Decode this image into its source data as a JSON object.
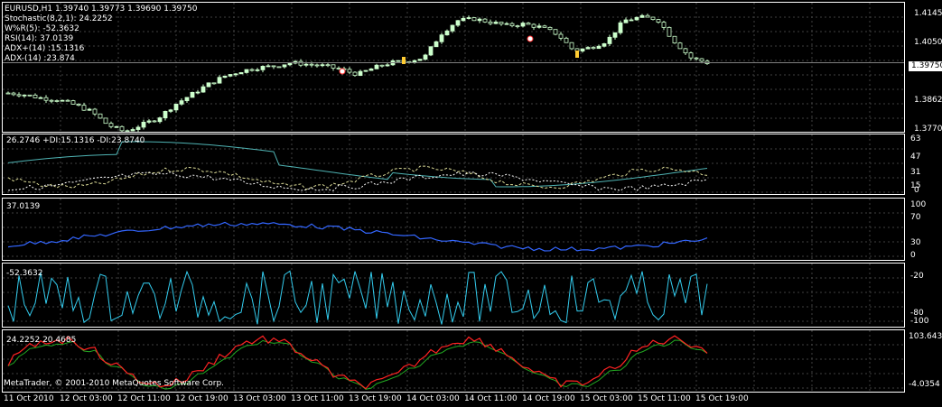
{
  "chart": {
    "header": "EURUSD,H1  1.39740 1.39773 1.39690 1.39750",
    "indicators_legend": [
      "Stochastic(8,2,1): 24.2252",
      "W%R(5): -52.3632",
      "RSI(14): 37.0139",
      "ADX+(14) :15.1316",
      "ADX-(14) :23.874"
    ],
    "current_price": "1.39750",
    "price_scale": [
      "1.41450",
      "1.40500",
      "1.39750",
      "1.38625",
      "1.37700"
    ],
    "copyright": "MetaTrader, © 2001-2010 MetaQuotes Software Corp."
  },
  "adx_pane": {
    "label": "26.2746  +DI:15.1316  -DI:23.8740",
    "scale": [
      "63",
      "47",
      "31",
      "15",
      "0"
    ]
  },
  "rsi_pane": {
    "label": "37.0139",
    "scale": [
      "100",
      "70",
      "30",
      "0"
    ]
  },
  "wpr_pane": {
    "label": "-52.3632",
    "scale": [
      "-20",
      "-80",
      "-100"
    ]
  },
  "stoch_pane": {
    "label": "24.2252  20.4685",
    "scale": [
      "103.6430",
      "-4.0354"
    ]
  },
  "time_axis": [
    "11 Oct 2010",
    "12 Oct 03:00",
    "12 Oct 11:00",
    "12 Oct 19:00",
    "13 Oct 03:00",
    "13 Oct 11:00",
    "13 Oct 19:00",
    "14 Oct 03:00",
    "14 Oct 11:00",
    "14 Oct 19:00",
    "15 Oct 03:00",
    "15 Oct 11:00",
    "15 Oct 19:00"
  ],
  "colors": {
    "background": "#000000",
    "grid": "#404040",
    "bull": "#ccffcc",
    "bear": "#00cc00",
    "adx": "#4fb3b3",
    "rsi": "#3366ff",
    "wpr": "#33ccee",
    "stoch_main": "#ff2222",
    "stoch_signal": "#22aa22"
  },
  "chart_data": {
    "type": "line",
    "price_y_range": [
      1.377,
      1.4145
    ],
    "close_series": [
      1.3885,
      1.388,
      1.387,
      1.3865,
      1.385,
      1.383,
      1.379,
      1.377,
      1.379,
      1.381,
      1.385,
      1.388,
      1.391,
      1.3935,
      1.395,
      1.396,
      1.3965,
      1.3975,
      1.397,
      1.3965,
      1.3955,
      1.394,
      1.396,
      1.3975,
      1.398,
      1.399,
      1.406,
      1.41,
      1.4105,
      1.4095,
      1.4085,
      1.409,
      1.408,
      1.406,
      1.401,
      1.402,
      1.404,
      1.41,
      1.411,
      1.4105,
      1.404,
      1.399,
      1.3975
    ]
  }
}
